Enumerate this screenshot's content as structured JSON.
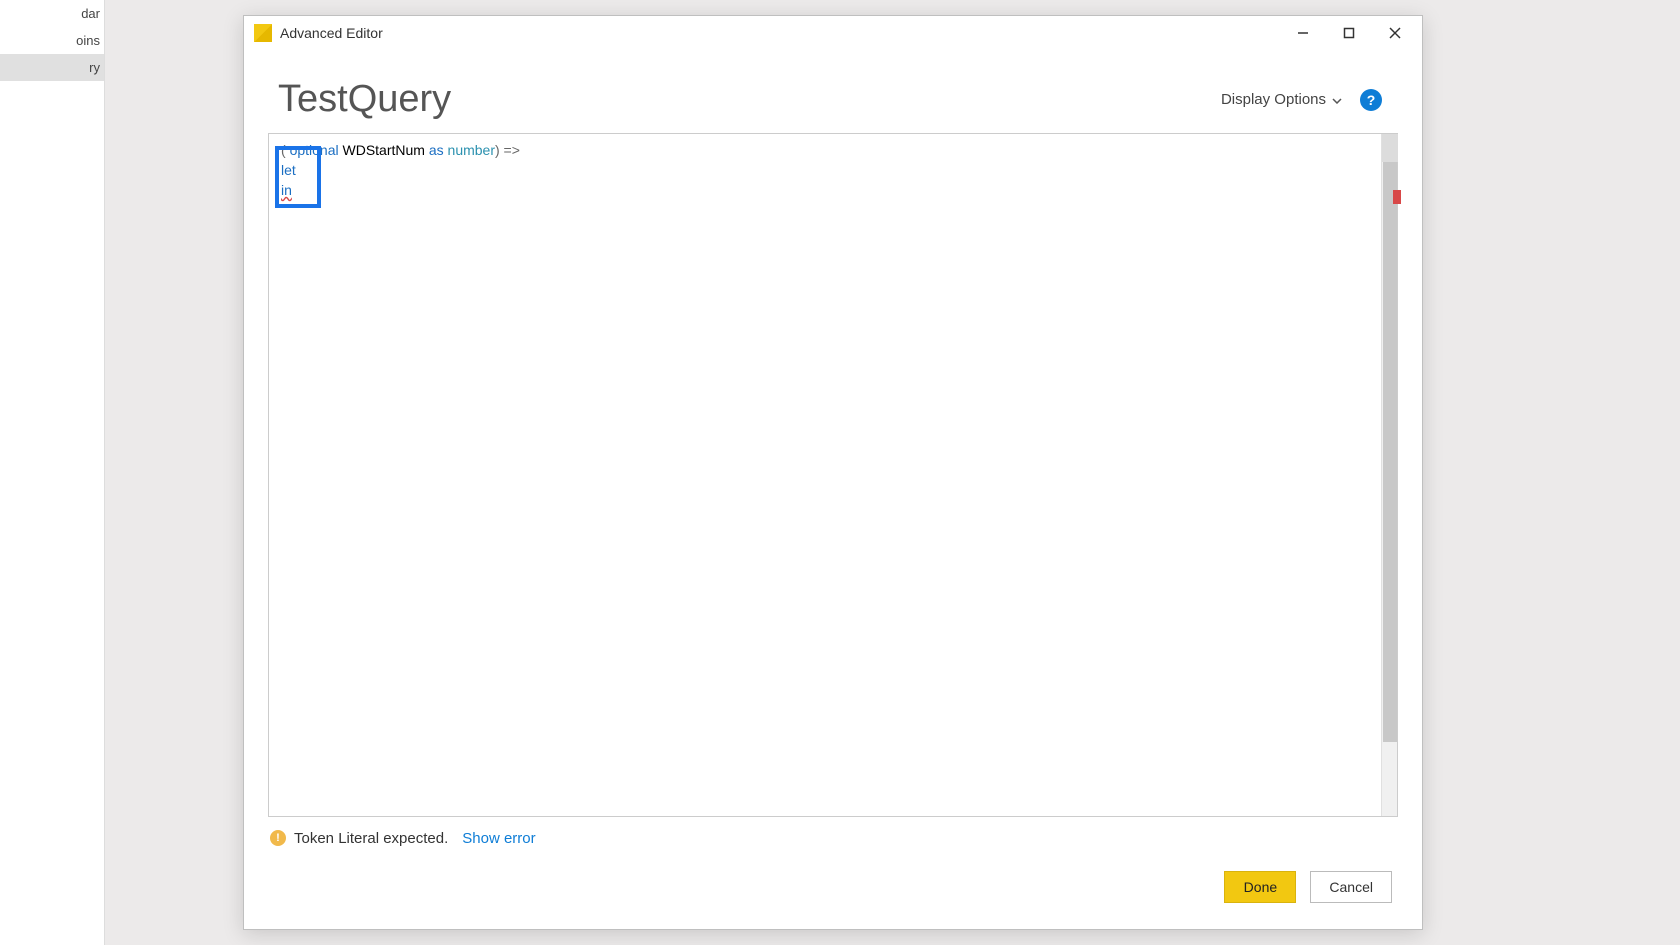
{
  "sidebar": {
    "items": [
      {
        "label": "dar"
      },
      {
        "label": "oins"
      },
      {
        "label": "ry"
      }
    ],
    "selected_index": 2
  },
  "dialog": {
    "titlebar": {
      "title": "Advanced Editor"
    },
    "query_name": "TestQuery",
    "display_options_label": "Display Options",
    "help_tooltip": "?",
    "code": {
      "line1_prefix": "( ",
      "line1_optional": "optional",
      "line1_param": " WDStartNum ",
      "line1_as": "as",
      "line1_space": " ",
      "line1_type": "number",
      "line1_suffix": ") =>",
      "line2_let": "let",
      "line3": "",
      "line4_in": "in"
    },
    "status": {
      "message": "Token Literal expected.",
      "show_error_label": "Show error"
    },
    "buttons": {
      "done": "Done",
      "cancel": "Cancel"
    }
  }
}
